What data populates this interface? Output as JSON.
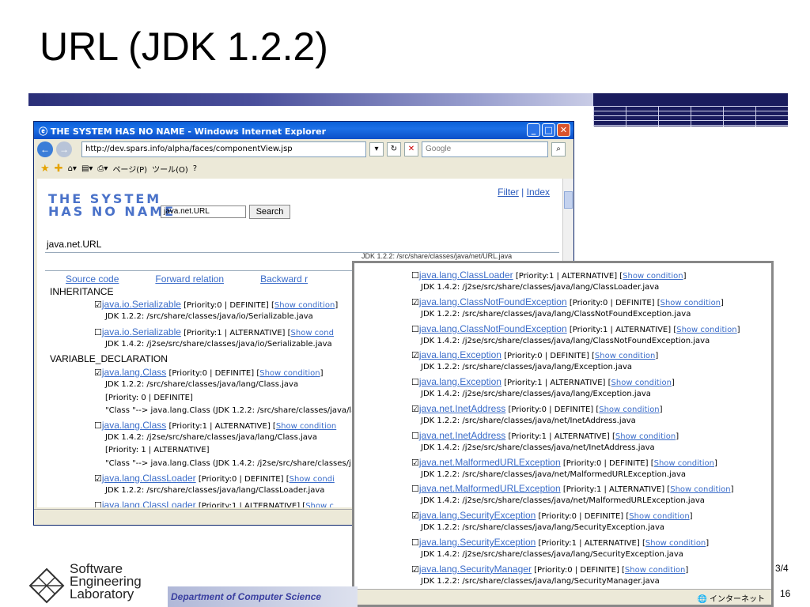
{
  "slide": {
    "title": "URL (JDK 1.2.2)",
    "page_fraction": "3/4",
    "page_number": "16",
    "department": "Department of Computer Science",
    "logo_lines": [
      "Software",
      "Engineering",
      "Laboratory"
    ]
  },
  "browser": {
    "window_title": "THE SYSTEM HAS NO NAME - Windows Internet Explorer",
    "address": "http://dev.spars.info/alpha/faces/componentView.jsp",
    "search_placeholder": "Google",
    "toolbar_page": "ページ(P)",
    "toolbar_tools": "ツール(O)"
  },
  "page": {
    "logo_line1": "THE SYSTEM",
    "logo_line2": "HAS NO NAME",
    "query": "java.net.URL",
    "search_button": "Search",
    "link_filter": "Filter",
    "link_index": "Index",
    "class_name": "java.net.URL",
    "source_path": "JDK 1.2.2: /src/share/classes/java/net/URL.java",
    "tabs": [
      "Source code",
      "Forward relation",
      "Backward r"
    ],
    "inheritance_label": "INHERITANCE",
    "variable_label": "VARIABLE_DECLARATION",
    "rows": [
      {
        "check": "☑",
        "name": "java.io.Serializable",
        "meta": "[Priority:0 | DEFINITE] [",
        "cond": "Show condition",
        "tail": "]"
      },
      {
        "text": "JDK 1.2.2: /src/share/classes/java/io/Serializable.java"
      },
      {
        "check": "☐",
        "name": "java.io.Serializable",
        "meta": "[Priority:1 | ALTERNATIVE] [",
        "cond": "Show cond",
        "tail": ""
      },
      {
        "text": "JDK 1.4.2: /j2se/src/share/classes/java/io/Serializable.java"
      },
      {
        "check": "☑",
        "name": "java.lang.Class",
        "meta": "[Priority:0 | DEFINITE] [",
        "cond": "Show condition",
        "tail": "]"
      },
      {
        "text": "JDK 1.2.2: /src/share/classes/java/lang/Class.java"
      },
      {
        "text": "[Priority: 0 | DEFINITE]"
      },
      {
        "text": "\"Class \"--> java.lang.Class (JDK 1.2.2: /src/share/classes/java/la"
      },
      {
        "check": "☐",
        "name": "java.lang.Class",
        "meta": "[Priority:1 | ALTERNATIVE] [",
        "cond": "Show condition",
        "tail": ""
      },
      {
        "text": "JDK 1.4.2: /j2se/src/share/classes/java/lang/Class.java"
      },
      {
        "text": "[Priority: 1 | ALTERNATIVE]"
      },
      {
        "text": "\"Class \"--> java.lang.Class (JDK 1.4.2: /j2se/src/share/classes/j"
      },
      {
        "check": "☑",
        "name": "java.lang.ClassLoader",
        "meta": "[Priority:0 | DEFINITE] [",
        "cond": "Show condi",
        "tail": ""
      },
      {
        "text": "JDK 1.2.2: /src/share/classes/java/lang/ClassLoader.java"
      },
      {
        "check": "☐",
        "name": "java.lang.ClassLoader",
        "meta": "[Priority:1 | ALTERNATIVE] [",
        "cond": "Show c",
        "tail": ""
      }
    ]
  },
  "popup": {
    "rows": [
      {
        "check": "☐",
        "name": "java.lang.ClassLoader",
        "meta": "[Priority:1 | ALTERNATIVE] [",
        "cond": "Show condition",
        "tail": "]"
      },
      {
        "text": "JDK 1.4.2: /j2se/src/share/classes/java/lang/ClassLoader.java"
      },
      {
        "check": "☑",
        "name": "java.lang.ClassNotFoundException",
        "meta": "[Priority:0 | DEFINITE] [",
        "cond": "Show condition",
        "tail": "]"
      },
      {
        "text": "JDK 1.2.2: /src/share/classes/java/lang/ClassNotFoundException.java"
      },
      {
        "check": "☐",
        "name": "java.lang.ClassNotFoundException",
        "meta": "[Priority:1 | ALTERNATIVE] [",
        "cond": "Show condition",
        "tail": "]"
      },
      {
        "text": "JDK 1.4.2: /j2se/src/share/classes/java/lang/ClassNotFoundException.java"
      },
      {
        "check": "☑",
        "name": "java.lang.Exception",
        "meta": "[Priority:0 | DEFINITE] [",
        "cond": "Show condition",
        "tail": "]"
      },
      {
        "text": "JDK 1.2.2: /src/share/classes/java/lang/Exception.java"
      },
      {
        "check": "☐",
        "name": "java.lang.Exception",
        "meta": "[Priority:1 | ALTERNATIVE] [",
        "cond": "Show condition",
        "tail": "]"
      },
      {
        "text": "JDK 1.4.2: /j2se/src/share/classes/java/lang/Exception.java"
      },
      {
        "check": "☑",
        "name": "java.net.InetAddress",
        "meta": "[Priority:0 | DEFINITE] [",
        "cond": "Show condition",
        "tail": "]"
      },
      {
        "text": "JDK 1.2.2: /src/share/classes/java/net/InetAddress.java"
      },
      {
        "check": "☐",
        "name": "java.net.InetAddress",
        "meta": "[Priority:1 | ALTERNATIVE] [",
        "cond": "Show condition",
        "tail": "]"
      },
      {
        "text": "JDK 1.4.2: /j2se/src/share/classes/java/net/InetAddress.java"
      },
      {
        "check": "☑",
        "name": "java.net.MalformedURLException",
        "meta": "[Priority:0 | DEFINITE] [",
        "cond": "Show condition",
        "tail": "]"
      },
      {
        "text": "JDK 1.2.2: /src/share/classes/java/net/MalformedURLException.java"
      },
      {
        "check": "☐",
        "name": "java.net.MalformedURLException",
        "meta": "[Priority:1 | ALTERNATIVE] [",
        "cond": "Show condition",
        "tail": "]"
      },
      {
        "text": "JDK 1.4.2: /j2se/src/share/classes/java/net/MalformedURLException.java"
      },
      {
        "check": "☑",
        "name": "java.lang.SecurityException",
        "meta": "[Priority:0 | DEFINITE] [",
        "cond": "Show condition",
        "tail": "]"
      },
      {
        "text": "JDK 1.2.2: /src/share/classes/java/lang/SecurityException.java"
      },
      {
        "check": "☐",
        "name": "java.lang.SecurityException",
        "meta": "[Priority:1 | ALTERNATIVE] [",
        "cond": "Show condition",
        "tail": "]"
      },
      {
        "text": "JDK 1.4.2: /j2se/src/share/classes/java/lang/SecurityException.java"
      },
      {
        "check": "☑",
        "name": "java.lang.SecurityManager",
        "meta": "[Priority:0 | DEFINITE] [",
        "cond": "Show condition",
        "tail": "]"
      },
      {
        "text": "JDK 1.2.2: /src/share/classes/java/lang/SecurityManager.java"
      }
    ],
    "zone": "インターネット"
  },
  "colors": {
    "link": "#3a6cc9",
    "band": "#2b2f78",
    "titlebar": "#0a5fd8"
  }
}
